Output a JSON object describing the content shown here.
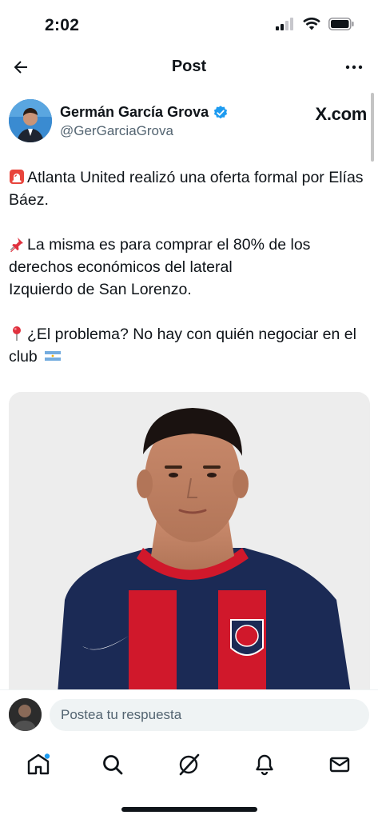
{
  "status_bar": {
    "time": "2:02"
  },
  "nav": {
    "title": "Post"
  },
  "author": {
    "name": "Germán García Grova",
    "handle": "@GerGarciaGrova",
    "source_label": "X.com",
    "verified_color": "#1d9bf0"
  },
  "tweet": {
    "line1_emoji": "siren-icon",
    "paragraph1": "Atlanta United realizó una oferta formal por Elías Báez.",
    "line2_emoji": "pushpin-icon",
    "paragraph2a": "La misma es para comprar el 80% de los derechos económicos del lateral",
    "paragraph2b": "Izquierdo de San Lorenzo.",
    "line3_emoji": "round-pushpin-icon",
    "paragraph3": "¿El problema? No hay con quién negociar en el club",
    "flag_emoji": "argentina-flag-icon"
  },
  "reply": {
    "placeholder": "Postea tu respuesta"
  },
  "tabs": [
    "home",
    "search",
    "grok",
    "notifications",
    "messages"
  ],
  "colors": {
    "accent": "#1d9bf0",
    "jersey_red": "#d0182b",
    "jersey_navy": "#1b2a55"
  }
}
